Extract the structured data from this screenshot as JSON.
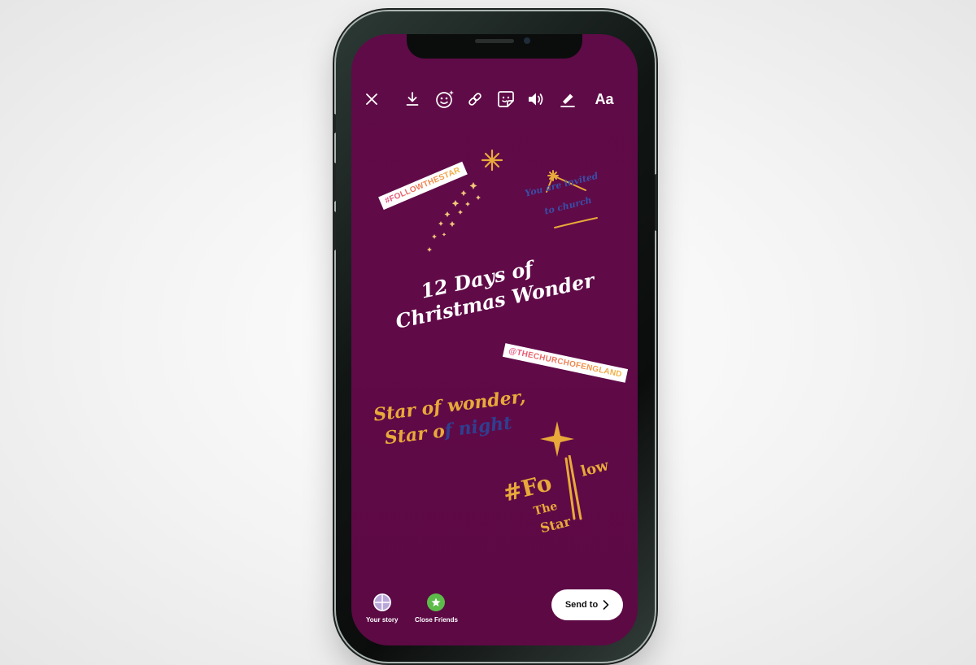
{
  "toolbar": {
    "icons": [
      "close-icon",
      "download-icon",
      "face-effects-icon",
      "link-icon",
      "sticker-icon",
      "sound-icon",
      "draw-icon"
    ],
    "text_tool_label": "Aa"
  },
  "stickers": {
    "hashtag_tag": "#FOLLOWTHESTAR",
    "invite_line1": "You are invited",
    "invite_line2": "to church",
    "headline_line1": "12 Days of",
    "headline_line2": "Christmas Wonder",
    "mention_tag": "@THECHURCHOFENGLAND",
    "lyric_line1": "Star of wonder,",
    "lyric_line2a": "Star o",
    "lyric_line2b": "f night",
    "follow_hash": "#Fo",
    "follow_low": "low",
    "follow_the": "The",
    "follow_star": "Star"
  },
  "bottom_bar": {
    "your_story_label": "Your story",
    "close_friends_label": "Close Friends",
    "send_label": "Send to"
  },
  "colors": {
    "background": "#5f0b47",
    "gold": "#e8a93a",
    "navy": "#2f3f8f",
    "close_friends_green": "#5dbb4a",
    "story_lavender": "#b9a6d9"
  }
}
